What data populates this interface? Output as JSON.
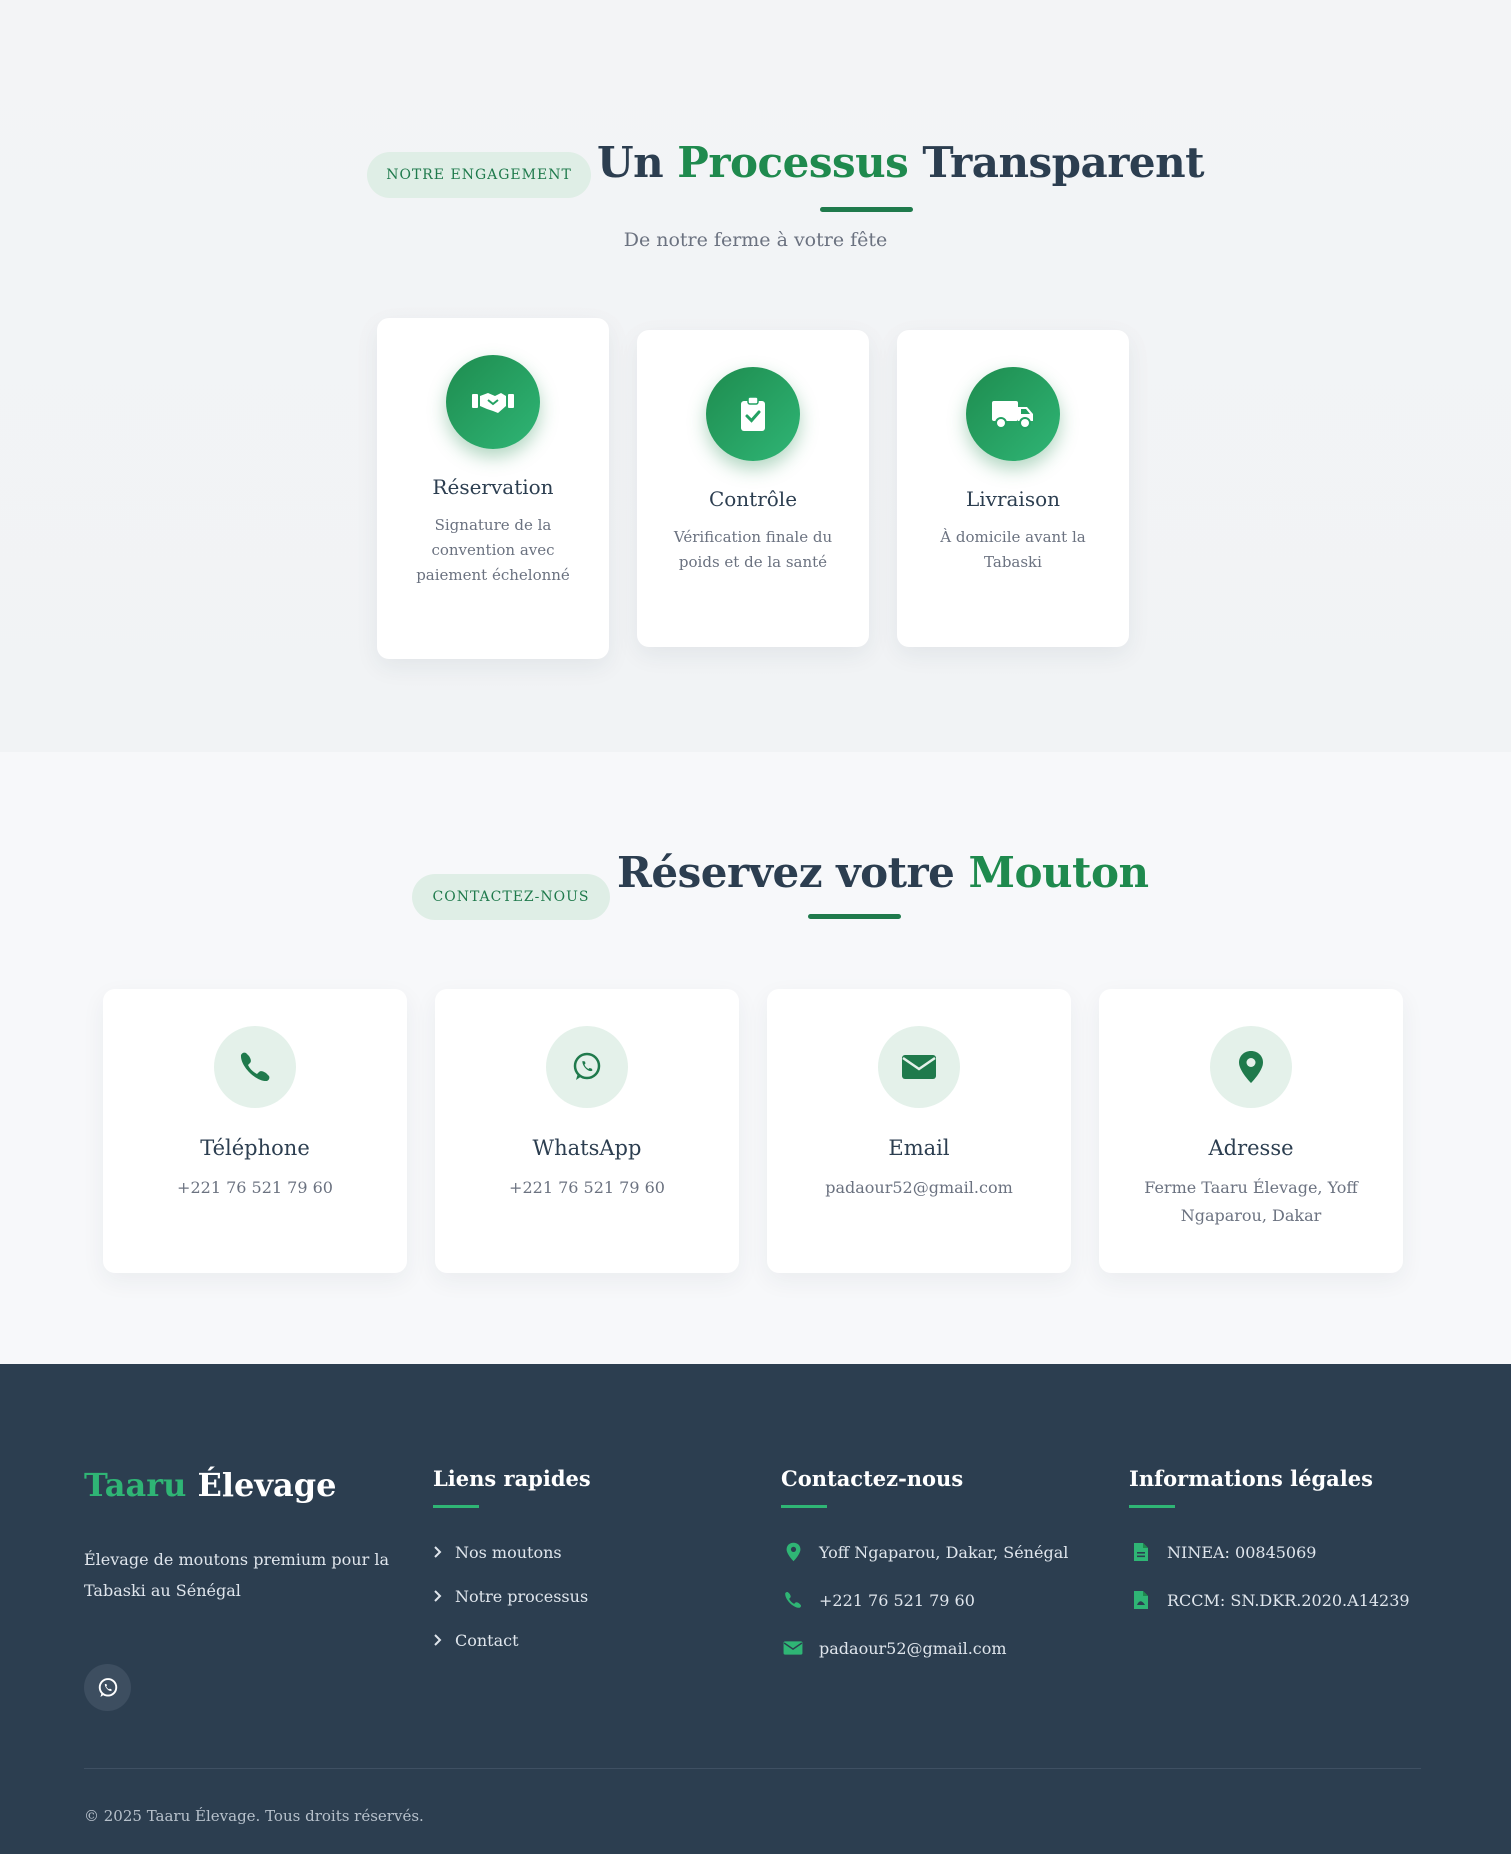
{
  "colors": {
    "primary_green": "#1f8a4e",
    "accent_green": "#2fb575",
    "dark": "#2c3e50",
    "pill_bg": "#dfeee6"
  },
  "process": {
    "badge": "NOTRE ENGAGEMENT",
    "title_part1": "Un ",
    "title_highlight": "Processus",
    "title_part2": " Transparent",
    "subtitle": "De notre ferme à votre fête",
    "steps": [
      {
        "icon": "handshake-icon",
        "title": "Réservation",
        "description": "Signature de la convention avec paiement échelonné"
      },
      {
        "icon": "clipboard-check-icon",
        "title": "Contrôle",
        "description": "Vérification finale du poids et de la santé"
      },
      {
        "icon": "truck-icon",
        "title": "Livraison",
        "description": "À domicile avant la Tabaski"
      }
    ]
  },
  "contact": {
    "badge": "CONTACTEZ-NOUS",
    "title_part1": "Réservez votre ",
    "title_highlight": "Mouton",
    "cards": [
      {
        "icon": "phone-icon",
        "title": "Téléphone",
        "value": "+221 76 521 79 60"
      },
      {
        "icon": "whatsapp-icon",
        "title": "WhatsApp",
        "value": "+221 76 521 79 60"
      },
      {
        "icon": "envelope-icon",
        "title": "Email",
        "value": "padaour52@gmail.com"
      },
      {
        "icon": "map-pin-icon",
        "title": "Adresse",
        "value": "Ferme Taaru Élevage, Yoff Ngaparou, Dakar"
      }
    ]
  },
  "footer": {
    "brand_highlight": "Taaru",
    "brand_rest": " Élevage",
    "description": "Élevage de moutons premium pour la Tabaski au Sénégal",
    "social_icon": "whatsapp-icon",
    "quick_links": {
      "title": "Liens rapides",
      "items": [
        "Nos moutons",
        "Notre processus",
        "Contact"
      ]
    },
    "contact": {
      "title": "Contactez-nous",
      "items": [
        {
          "icon": "map-pin-icon",
          "text": "Yoff Ngaparou, Dakar, Sénégal"
        },
        {
          "icon": "phone-icon",
          "text": "+221 76 521 79 60"
        },
        {
          "icon": "envelope-icon",
          "text": "padaour52@gmail.com"
        }
      ]
    },
    "legal": {
      "title": "Informations légales",
      "items": [
        {
          "icon": "file-icon",
          "text": "NINEA: 00845069"
        },
        {
          "icon": "file-pdf-icon",
          "text": "RCCM: SN.DKR.2020.A14239"
        }
      ]
    },
    "copyright": "© 2025 Taaru Élevage. Tous droits réservés."
  }
}
